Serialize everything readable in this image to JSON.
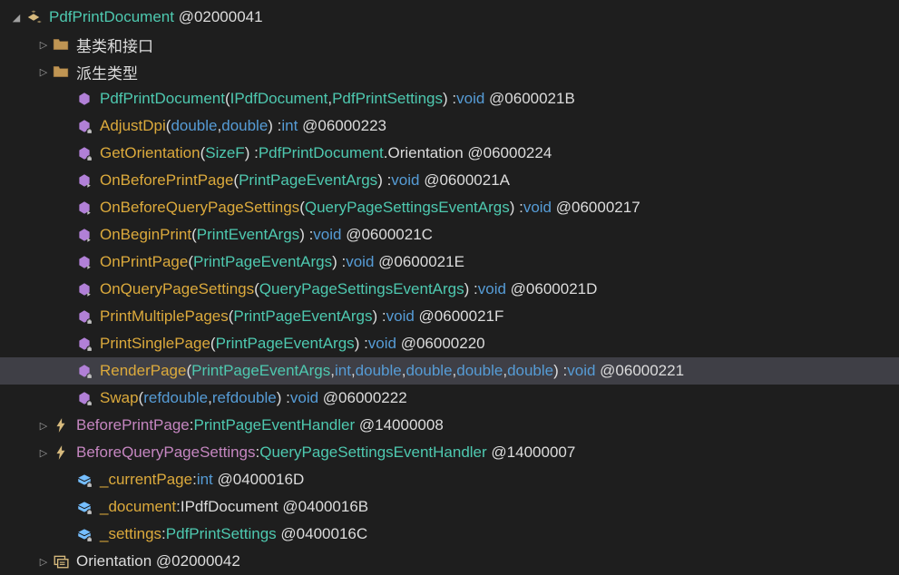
{
  "root": {
    "name": "PdfPrintDocument",
    "id": "@02000041"
  },
  "folders": [
    {
      "label": "基类和接口"
    },
    {
      "label": "派生类型"
    }
  ],
  "ctor": {
    "name": "PdfPrintDocument",
    "p1": "IPdfDocument",
    "p2": "PdfPrintSettings",
    "ret": "void",
    "id": "@0600021B"
  },
  "methods": {
    "adjustDpi": {
      "name": "AdjustDpi",
      "p1": "double",
      "p2": "double",
      "ret": "int",
      "id": "@06000223"
    },
    "getOrientation": {
      "name": "GetOrientation",
      "p1": "SizeF",
      "rettype": "PdfPrintDocument",
      "retsuffix": ".Orientation",
      "id": "@06000224"
    },
    "onBeforePrintPage": {
      "name": "OnBeforePrintPage",
      "p1": "PrintPageEventArgs",
      "ret": "void",
      "id": "@0600021A"
    },
    "onBeforeQuery": {
      "name": "OnBeforeQueryPageSettings",
      "p1": "QueryPageSettingsEventArgs",
      "ret": "void",
      "id": "@06000217"
    },
    "onBeginPrint": {
      "name": "OnBeginPrint",
      "p1": "PrintEventArgs",
      "ret": "void",
      "id": "@0600021C"
    },
    "onPrintPage": {
      "name": "OnPrintPage",
      "p1": "PrintPageEventArgs",
      "ret": "void",
      "id": "@0600021E"
    },
    "onQueryPage": {
      "name": "OnQueryPageSettings",
      "p1": "QueryPageSettingsEventArgs",
      "ret": "void",
      "id": "@0600021D"
    },
    "printMulti": {
      "name": "PrintMultiplePages",
      "p1": "PrintPageEventArgs",
      "ret": "void",
      "id": "@0600021F"
    },
    "printSingle": {
      "name": "PrintSinglePage",
      "p1": "PrintPageEventArgs",
      "ret": "void",
      "id": "@06000220"
    },
    "renderPage": {
      "name": "RenderPage",
      "p1": "PrintPageEventArgs",
      "p2": "int",
      "p3": "double",
      "p4": "double",
      "p5": "double",
      "p6": "double",
      "ret": "void",
      "id": "@06000221"
    },
    "swap": {
      "name": "Swap",
      "pref": "ref",
      "p1": "double",
      "p2": "double",
      "ret": "void",
      "id": "@06000222"
    }
  },
  "events": {
    "beforePrint": {
      "name": "BeforePrintPage",
      "type": "PrintPageEventHandler",
      "id": "@14000008"
    },
    "beforeQuery": {
      "name": "BeforeQueryPageSettings",
      "type": "QueryPageSettingsEventHandler",
      "id": "@14000007"
    }
  },
  "fields": {
    "currentPage": {
      "name": "_currentPage",
      "type": "int",
      "id": "@0400016D"
    },
    "document": {
      "name": "_document",
      "type": "IPdfDocument",
      "id": "@0400016B"
    },
    "settings": {
      "name": "_settings",
      "type": "PdfPrintSettings",
      "id": "@0400016C"
    }
  },
  "nestedType": {
    "name": "Orientation",
    "id": "@02000042"
  }
}
